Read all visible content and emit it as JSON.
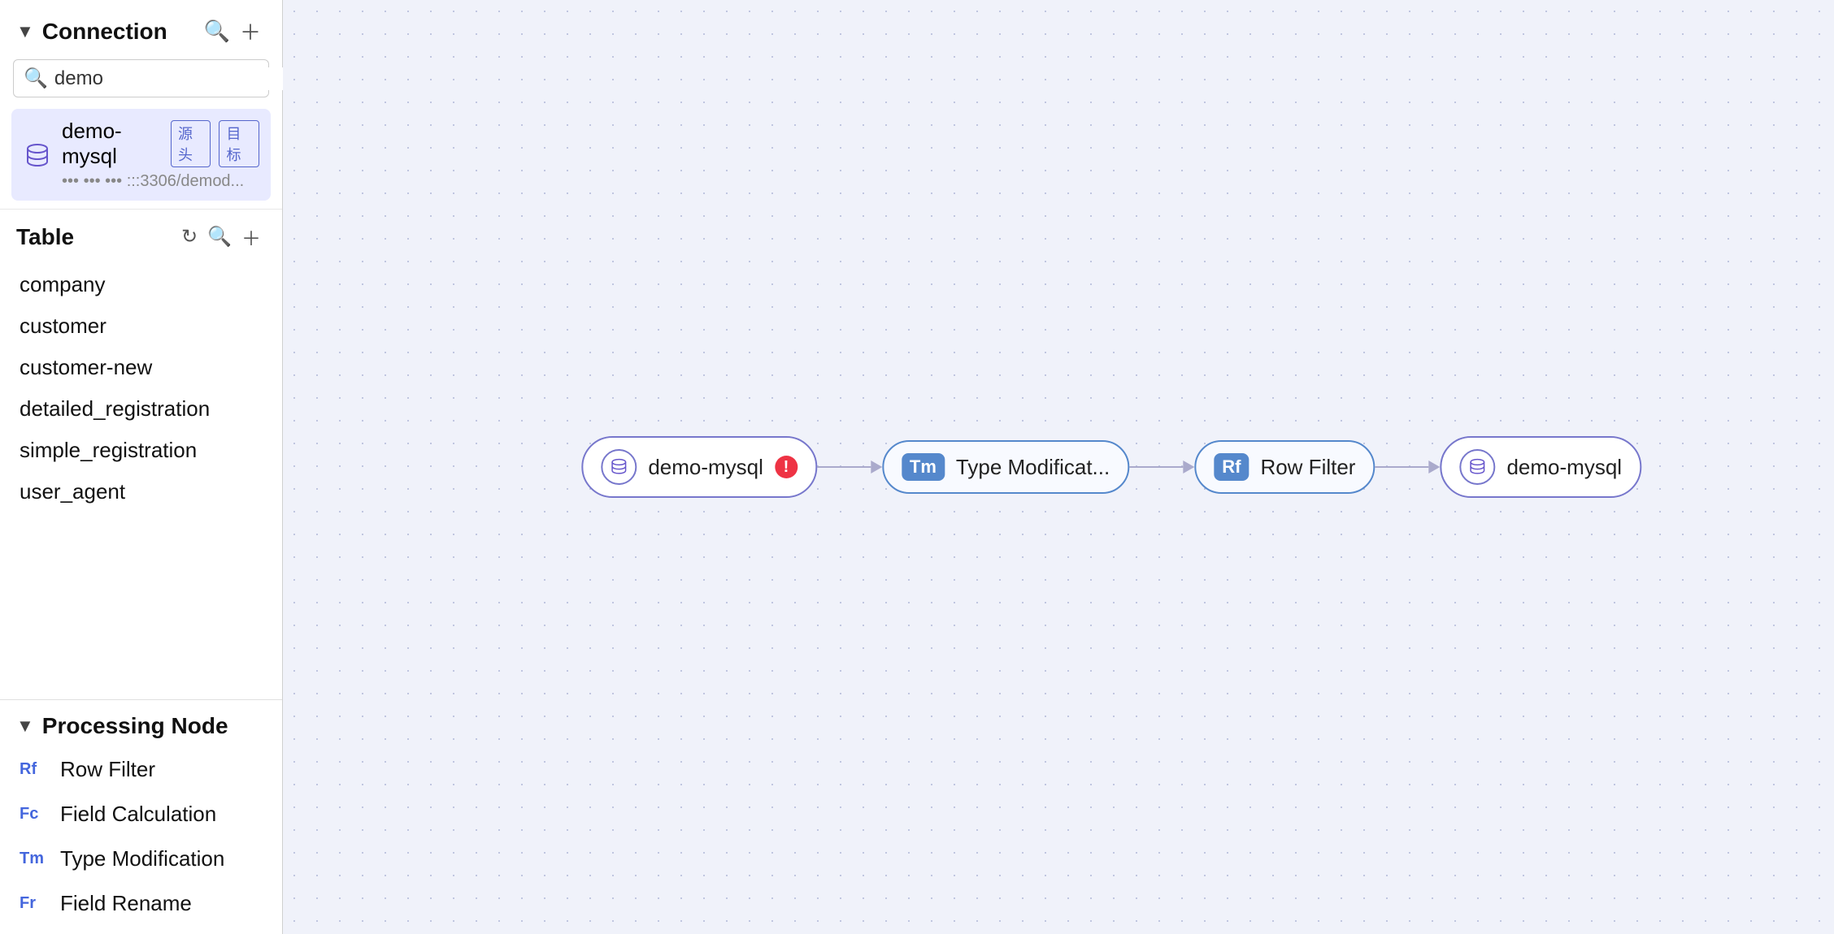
{
  "sidebar": {
    "connection_section": {
      "title": "Connection",
      "search_placeholder": "demo",
      "search_value": "demo",
      "add_label": "+",
      "search_icon": "search-icon"
    },
    "connection_item": {
      "name": "demo-mysql",
      "badge_source": "源头",
      "badge_target": "目标",
      "url": "••• ••• ••• :::3306/demod..."
    },
    "table_section": {
      "title": "Table",
      "items": [
        "company",
        "customer",
        "customer-new",
        "detailed_registration",
        "simple_registration",
        "user_agent"
      ]
    },
    "processing_section": {
      "title": "Processing Node",
      "items": [
        {
          "badge": "Rf",
          "label": "Row Filter"
        },
        {
          "badge": "Fc",
          "label": "Field Calculation"
        },
        {
          "badge": "Tm",
          "label": "Type Modification"
        },
        {
          "badge": "Fr",
          "label": "Field Rename"
        }
      ]
    }
  },
  "canvas": {
    "nodes": [
      {
        "id": "source",
        "type": "source",
        "icon": "db-icon",
        "label": "demo-mysql",
        "has_error": true
      },
      {
        "id": "type-mod",
        "type": "proc",
        "badge": "Tm",
        "label": "Type Modificat..."
      },
      {
        "id": "row-filter",
        "type": "proc",
        "badge": "Rf",
        "label": "Row Filter"
      },
      {
        "id": "dest",
        "type": "dest",
        "icon": "db-icon",
        "label": "demo-mysql"
      }
    ]
  }
}
